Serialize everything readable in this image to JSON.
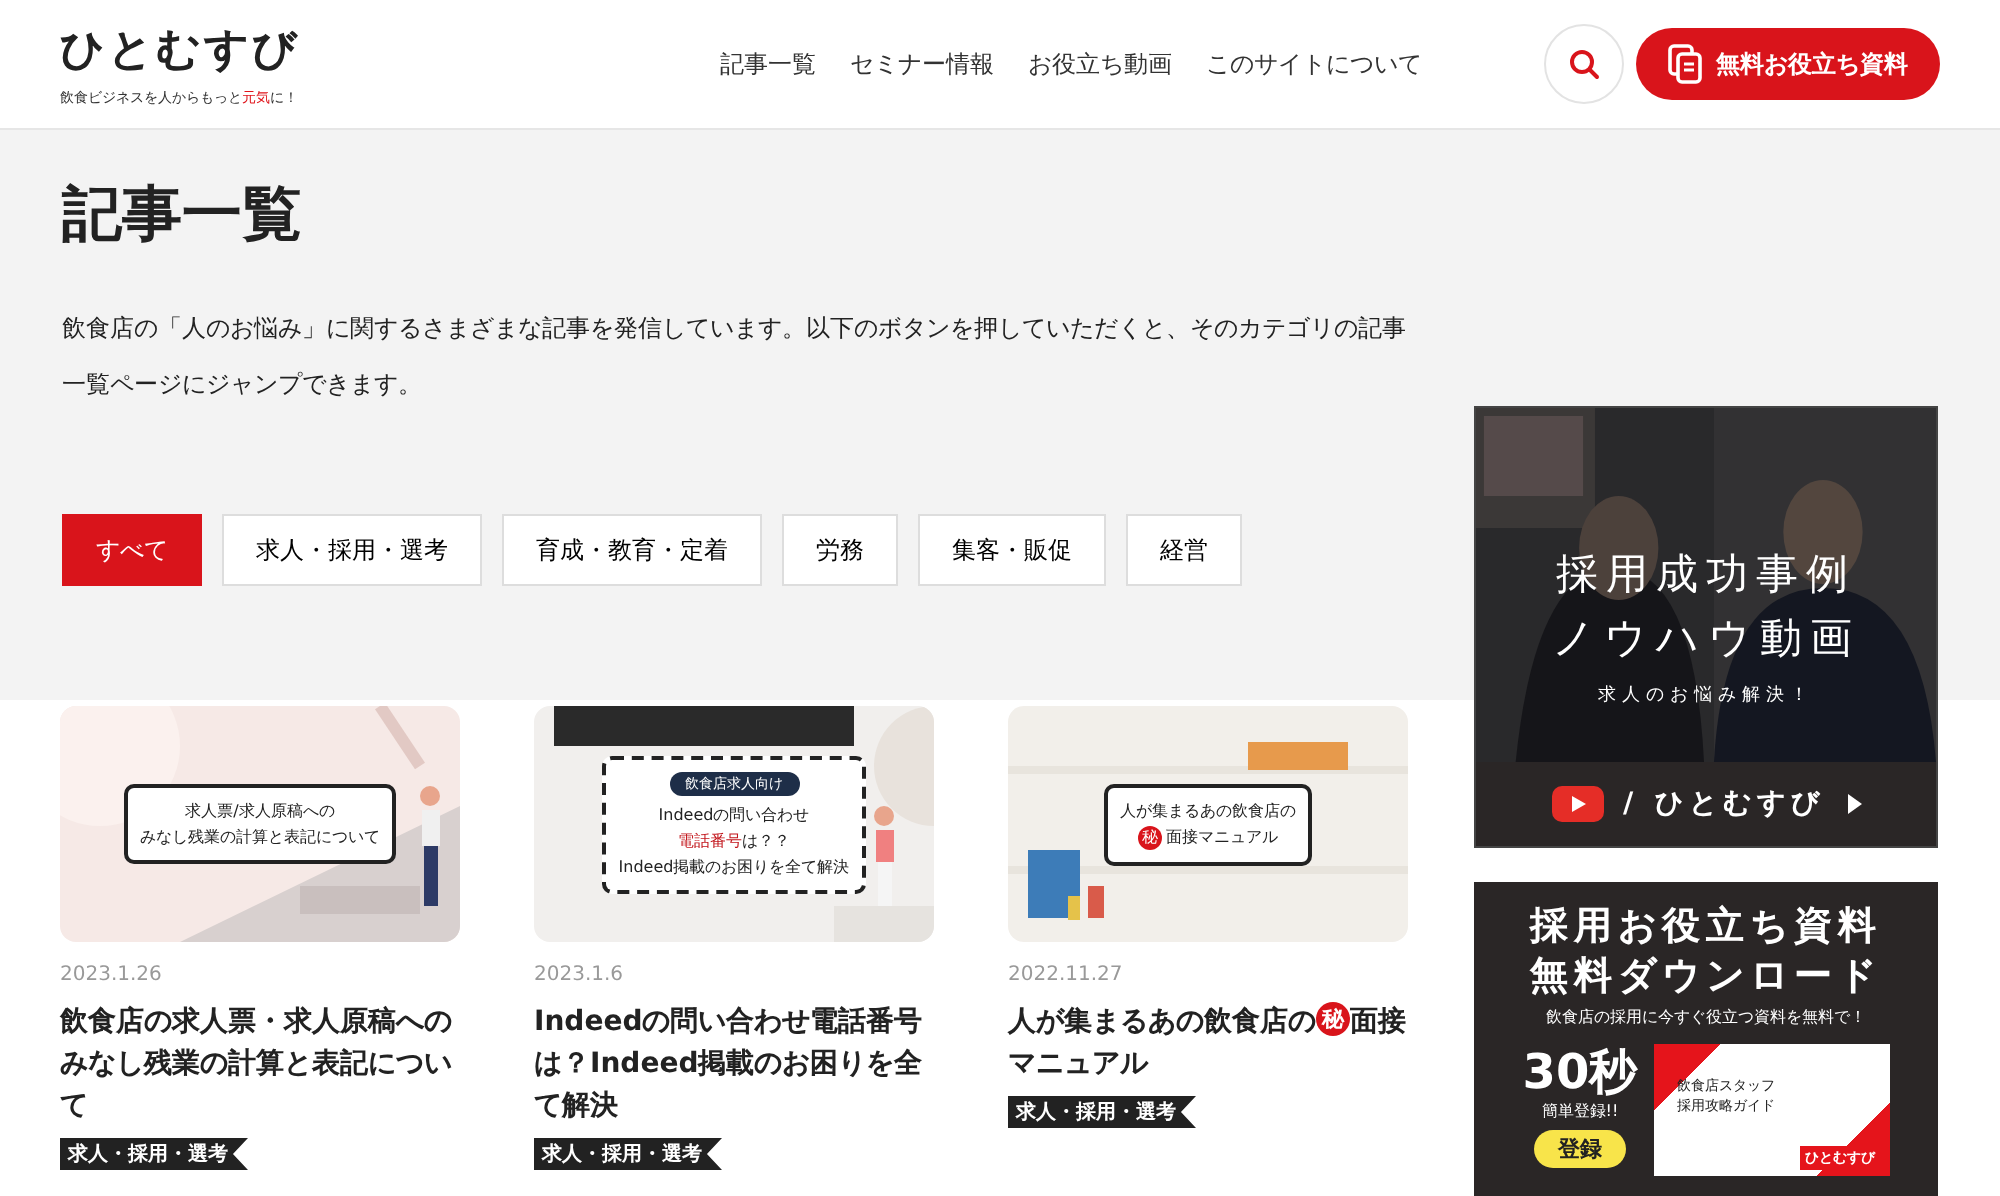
{
  "header": {
    "logo": "ひとむすび",
    "tagline": [
      {
        "text": "飲食ビジネスを人からもっと",
        "highlight": false
      },
      {
        "text": "元気",
        "highlight": true
      },
      {
        "text": "に！",
        "highlight": false
      }
    ],
    "nav": [
      "記事一覧",
      "セミナー情報",
      "お役立ち動画",
      "このサイトについて"
    ],
    "cta": "無料お役立ち資料"
  },
  "page": {
    "title": "記事一覧",
    "intro": "飲食店の「人のお悩み」に関するさまざまな記事を発信しています。以下のボタンを押していただくと、そのカテゴリの記事一覧ページにジャンプできます。",
    "filters": [
      {
        "label": "すべて",
        "selected": true
      },
      {
        "label": "求人・採用・選考",
        "selected": false
      },
      {
        "label": "育成・教育・定着",
        "selected": false
      },
      {
        "label": "労務",
        "selected": false
      },
      {
        "label": "集客・販促",
        "selected": false
      },
      {
        "label": "経営",
        "selected": false
      }
    ]
  },
  "articles": [
    {
      "thumbnail": {
        "kind": "solid",
        "lines": [
          [
            {
              "kind": "text",
              "text": "求人票/求人原稿への"
            }
          ],
          [
            {
              "kind": "text",
              "text": "みなし残業の計算と表記について"
            }
          ]
        ]
      },
      "date": "2023.1.26",
      "title": [
        {
          "kind": "text",
          "text": "飲食店の求人票・求人原稿へのみなし残業の計算と表記について"
        }
      ],
      "tag": "求人・採用・選考"
    },
    {
      "thumbnail": {
        "kind": "dashed",
        "badge": "飲食店求人向け",
        "lines": [
          [
            {
              "kind": "text",
              "text": "Indeedの問い合わせ"
            }
          ],
          [
            {
              "kind": "red",
              "text": "電話番号"
            },
            {
              "kind": "text",
              "text": "は？？"
            }
          ],
          [
            {
              "kind": "text",
              "text": "Indeed掲載のお困りを全て解決"
            }
          ]
        ]
      },
      "date": "2023.1.6",
      "title": [
        {
          "kind": "text",
          "text": "Indeedの問い合わせ電話番号は？Indeed掲載のお困りを全て解決"
        }
      ],
      "tag": "求人・採用・選考"
    },
    {
      "thumbnail": {
        "kind": "solid",
        "lines": [
          [
            {
              "kind": "text",
              "text": "人が集まるあの飲食店の"
            }
          ],
          [
            {
              "kind": "circle",
              "text": "秘"
            },
            {
              "kind": "text",
              "text": "面接マニュアル"
            }
          ]
        ]
      },
      "date": "2022.11.27",
      "title": [
        {
          "kind": "text",
          "text": "人が集まるあの飲食店の"
        },
        {
          "kind": "circle",
          "text": "秘"
        },
        {
          "kind": "text",
          "text": "面接マニュアル"
        }
      ],
      "tag": "求人・採用・選考"
    }
  ],
  "sidebar": {
    "video_banner": {
      "lines": [
        "採用成功事例",
        "ノウハウ動画"
      ],
      "sub": "求人のお悩み解決！",
      "channel": "/ ひとむすび"
    },
    "download_banner": {
      "lines": [
        "採用お役立ち資料",
        "無料ダウンロード"
      ],
      "sub": "飲食店の採用に今すぐ役立つ資料を無料で！",
      "seconds": "30秒",
      "easy": "簡単登録!!",
      "book_title": [
        "飲食店スタッフ",
        "採用攻略ガイド"
      ],
      "book_brand": "ひとむすび",
      "button": "登録"
    }
  }
}
